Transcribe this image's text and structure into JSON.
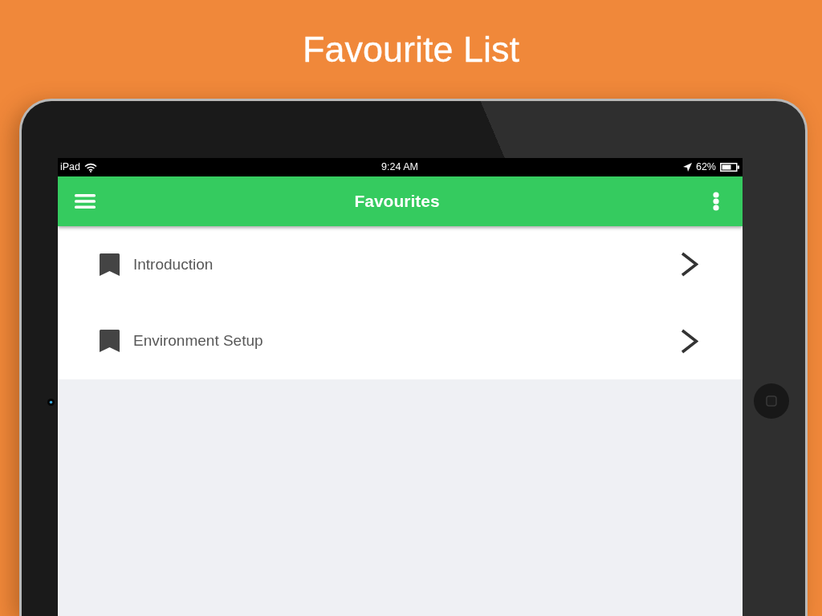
{
  "page": {
    "title": "Favourite List"
  },
  "status_bar": {
    "carrier": "iPad",
    "time": "9:24 AM",
    "battery": "62%"
  },
  "app_bar": {
    "title": "Favourites"
  },
  "favourites": [
    {
      "label": "Introduction"
    },
    {
      "label": "Environment Setup"
    }
  ]
}
